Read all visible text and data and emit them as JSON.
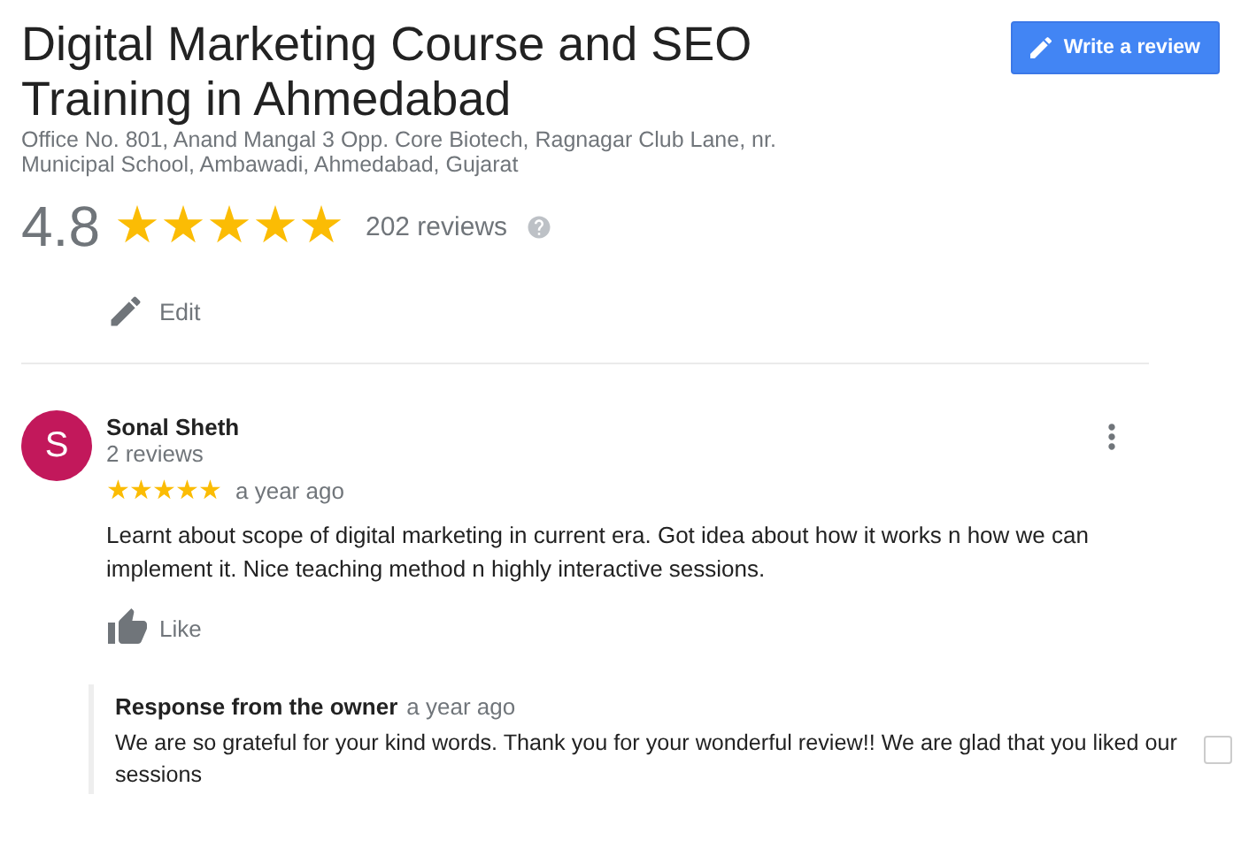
{
  "place": {
    "title_lines": [
      "Digital Marketing Course and SEO",
      "Training in Ahmedabad"
    ],
    "address_lines": [
      "Office No. 801, Anand Mangal 3 Opp. Core Biotech, Ragnagar Club Lane, nr.",
      "Municipal School, Ambawadi, Ahmedabad, Gujarat"
    ],
    "rating": "4.8",
    "stars": 5,
    "review_count": "202 reviews",
    "edit_label": "Edit"
  },
  "write_review_button": "Write a review",
  "reviews": [
    {
      "initial": "S",
      "color": "#c2185b",
      "name": "Sonal Sheth",
      "review_count": "2 reviews",
      "stars": 5,
      "time": "a year ago",
      "text": "Learnt about scope of digital marketing in current era. Got idea about how it works n how we can implement it. Nice teaching method n highly interactive sessions.",
      "like_label": "Like",
      "response": {
        "heading": "Response from the owner",
        "time": "a year ago",
        "text": "We are so grateful for your kind words. Thank you for your wonderful review!! We are glad that you liked our sessions"
      }
    }
  ]
}
